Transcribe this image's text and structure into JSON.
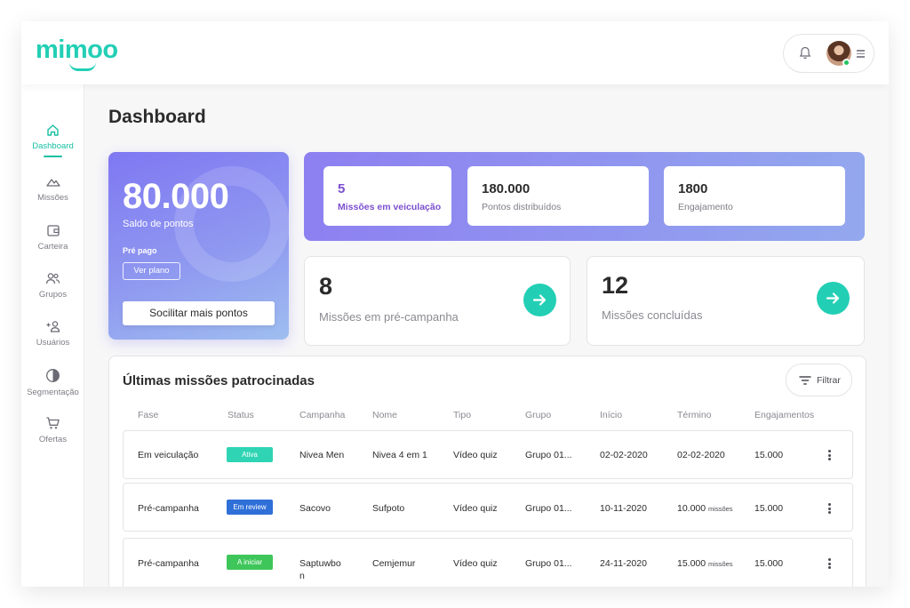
{
  "app": {
    "logo": "mimoo"
  },
  "sidebar": {
    "items": [
      {
        "label": "Dashboard",
        "icon": "home-icon",
        "active": true
      },
      {
        "label": "Missões",
        "icon": "mountain-icon"
      },
      {
        "label": "Carteira",
        "icon": "wallet-icon"
      },
      {
        "label": "Grupos",
        "icon": "group-icon"
      },
      {
        "label": "Usuários",
        "icon": "add-user-icon"
      },
      {
        "label": "Segmentação",
        "icon": "pie-icon"
      },
      {
        "label": "Ofertas",
        "icon": "cart-icon"
      }
    ]
  },
  "page": {
    "title": "Dashboard"
  },
  "points_card": {
    "value": "80.000",
    "label": "Saldo de pontos",
    "plan_type": "Pré pago",
    "plan_button": "Ver plano",
    "request_button": "Socilitar mais pontos"
  },
  "stats": [
    {
      "value": "5",
      "label": "Missões em veiculação"
    },
    {
      "value": "180.000",
      "label": "Pontos distribuídos"
    },
    {
      "value": "1800",
      "label": "Engajamento"
    }
  ],
  "counts": [
    {
      "value": "8",
      "label": "Missões em pré-campanha"
    },
    {
      "value": "12",
      "label": "Missões concluídas"
    }
  ],
  "table": {
    "title": "Últimas missões patrocinadas",
    "filter_label": "Filtrar",
    "headers": [
      "Fase",
      "Status",
      "Campanha",
      "Nome",
      "Tipo",
      "Grupo",
      "Início",
      "Término",
      "Engajamentos"
    ],
    "rows": [
      {
        "fase": "Em veiculação",
        "status": "Ativa",
        "campanha": "Nivea Men",
        "campanha2": "",
        "nome": "Nivea 4 em 1",
        "tipo": "Vídeo quiz",
        "grupo": "Grupo 01...",
        "inicio": "02-02-2020",
        "termino": "02-02-2020",
        "termino_unit": "",
        "engajamentos": "15.000"
      },
      {
        "fase": "Pré-campanha",
        "status": "Em review",
        "campanha": "Sacovo",
        "campanha2": "",
        "nome": "Sufpoto",
        "tipo": "Vídeo quiz",
        "grupo": "Grupo 01...",
        "inicio": "10-11-2020",
        "termino": "10.000",
        "termino_unit": "missões",
        "engajamentos": "15.000"
      },
      {
        "fase": "Pré-campanha",
        "status": "A iniciar",
        "campanha": "Saptuwbo",
        "campanha2": "n",
        "nome": "Cemjemur",
        "tipo": "Vídeo quiz",
        "grupo": "Grupo 01...",
        "inicio": "24-11-2020",
        "termino": "15.000",
        "termino_unit": "missões",
        "engajamentos": "15.000"
      }
    ]
  },
  "colors": {
    "accent": "#22cfb5",
    "purple": "#7c4fd0",
    "status_ativa": "#2fd4b4",
    "status_review": "#2f6fd8",
    "status_iniciar": "#3fc65a"
  }
}
